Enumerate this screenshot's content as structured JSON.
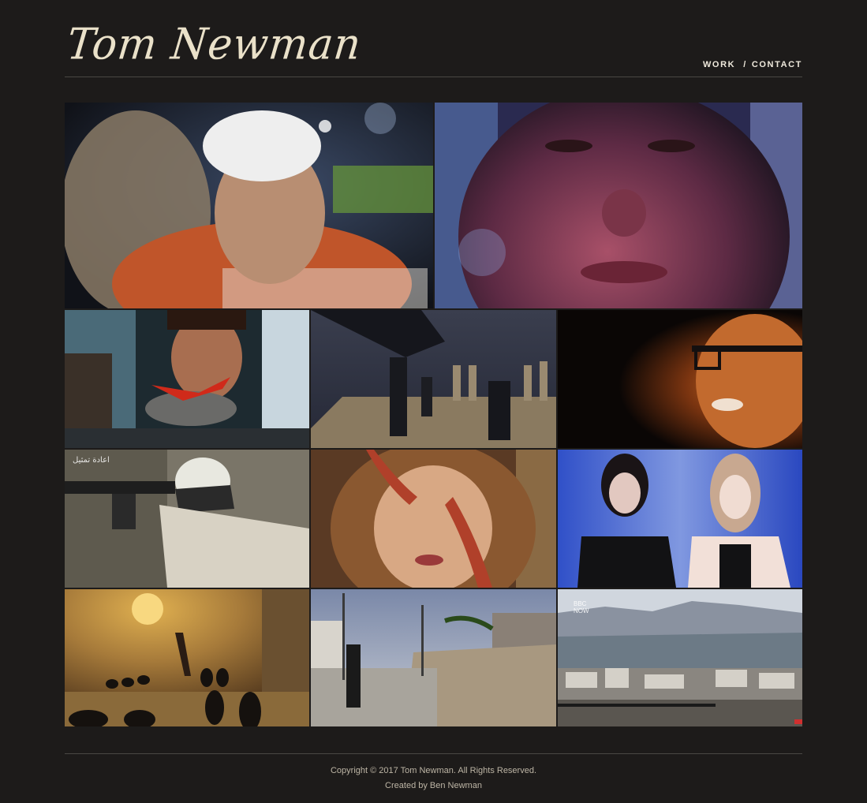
{
  "site": {
    "logo_text": "Tom Newman"
  },
  "nav": {
    "work_label": "WORK",
    "separator": "/",
    "contact_label": "CONTACT"
  },
  "footer": {
    "copyright": "Copyright © 2017 Tom Newman. All Rights Reserved.",
    "credit": "Created by Ben Newman"
  },
  "colors": {
    "background": "#1d1b1a",
    "text": "#e6dfcf",
    "divider": "#4a4744"
  },
  "tiles": [
    {
      "name": "tile-old-man",
      "overlay_text": ""
    },
    {
      "name": "tile-face-closeup",
      "overlay_text": ""
    },
    {
      "name": "tile-man-chillies",
      "overlay_text": ""
    },
    {
      "name": "tile-chess",
      "overlay_text": ""
    },
    {
      "name": "tile-glasses-laughing",
      "overlay_text": ""
    },
    {
      "name": "tile-gunman",
      "overlay_text": "اعادة تمثيل"
    },
    {
      "name": "tile-octopus-girl",
      "overlay_text": ""
    },
    {
      "name": "tile-two-models",
      "overlay_text": ""
    },
    {
      "name": "tile-tyres-dancer",
      "overlay_text": ""
    },
    {
      "name": "tile-hurricane-street",
      "overlay_text": ""
    },
    {
      "name": "tile-city-mountains",
      "overlay_text": "BBC NOW"
    }
  ]
}
